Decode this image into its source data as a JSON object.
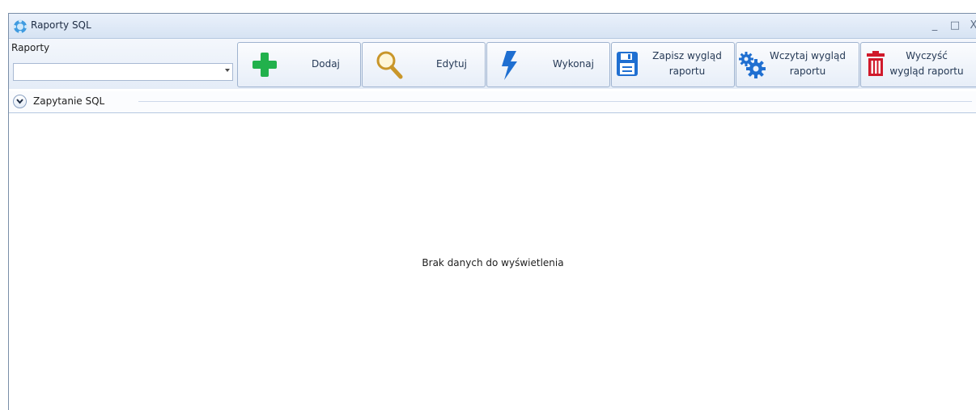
{
  "window": {
    "title": "Raporty SQL",
    "controls": {
      "minimize": "_",
      "maximize": "□",
      "close": "X"
    }
  },
  "toolbar": {
    "combo_label": "Raporty",
    "combo_value": "",
    "buttons": [
      {
        "id": "add",
        "label": "Dodaj",
        "icon": "plus-icon",
        "color": "#22b14c"
      },
      {
        "id": "edit",
        "label": "Edytuj",
        "icon": "magnifier-icon",
        "color": "#c9962a"
      },
      {
        "id": "run",
        "label": "Wykonaj",
        "icon": "lightning-icon",
        "color": "#1f6fd1"
      },
      {
        "id": "save",
        "label_line1": "Zapisz wygląd",
        "label_line2": "raportu",
        "icon": "floppy-icon",
        "color": "#1f6fd1"
      },
      {
        "id": "load",
        "label_line1": "Wczytaj wygląd",
        "label_line2": "raportu",
        "icon": "gears-icon",
        "color": "#1f6fd1"
      },
      {
        "id": "clear",
        "label_line1": "Wyczyść",
        "label_line2": "wygląd raportu",
        "icon": "trash-icon",
        "color": "#d0192b"
      }
    ]
  },
  "section": {
    "title": "Zapytanie SQL"
  },
  "grid": {
    "empty_message": "Brak danych do wyświetlenia"
  }
}
